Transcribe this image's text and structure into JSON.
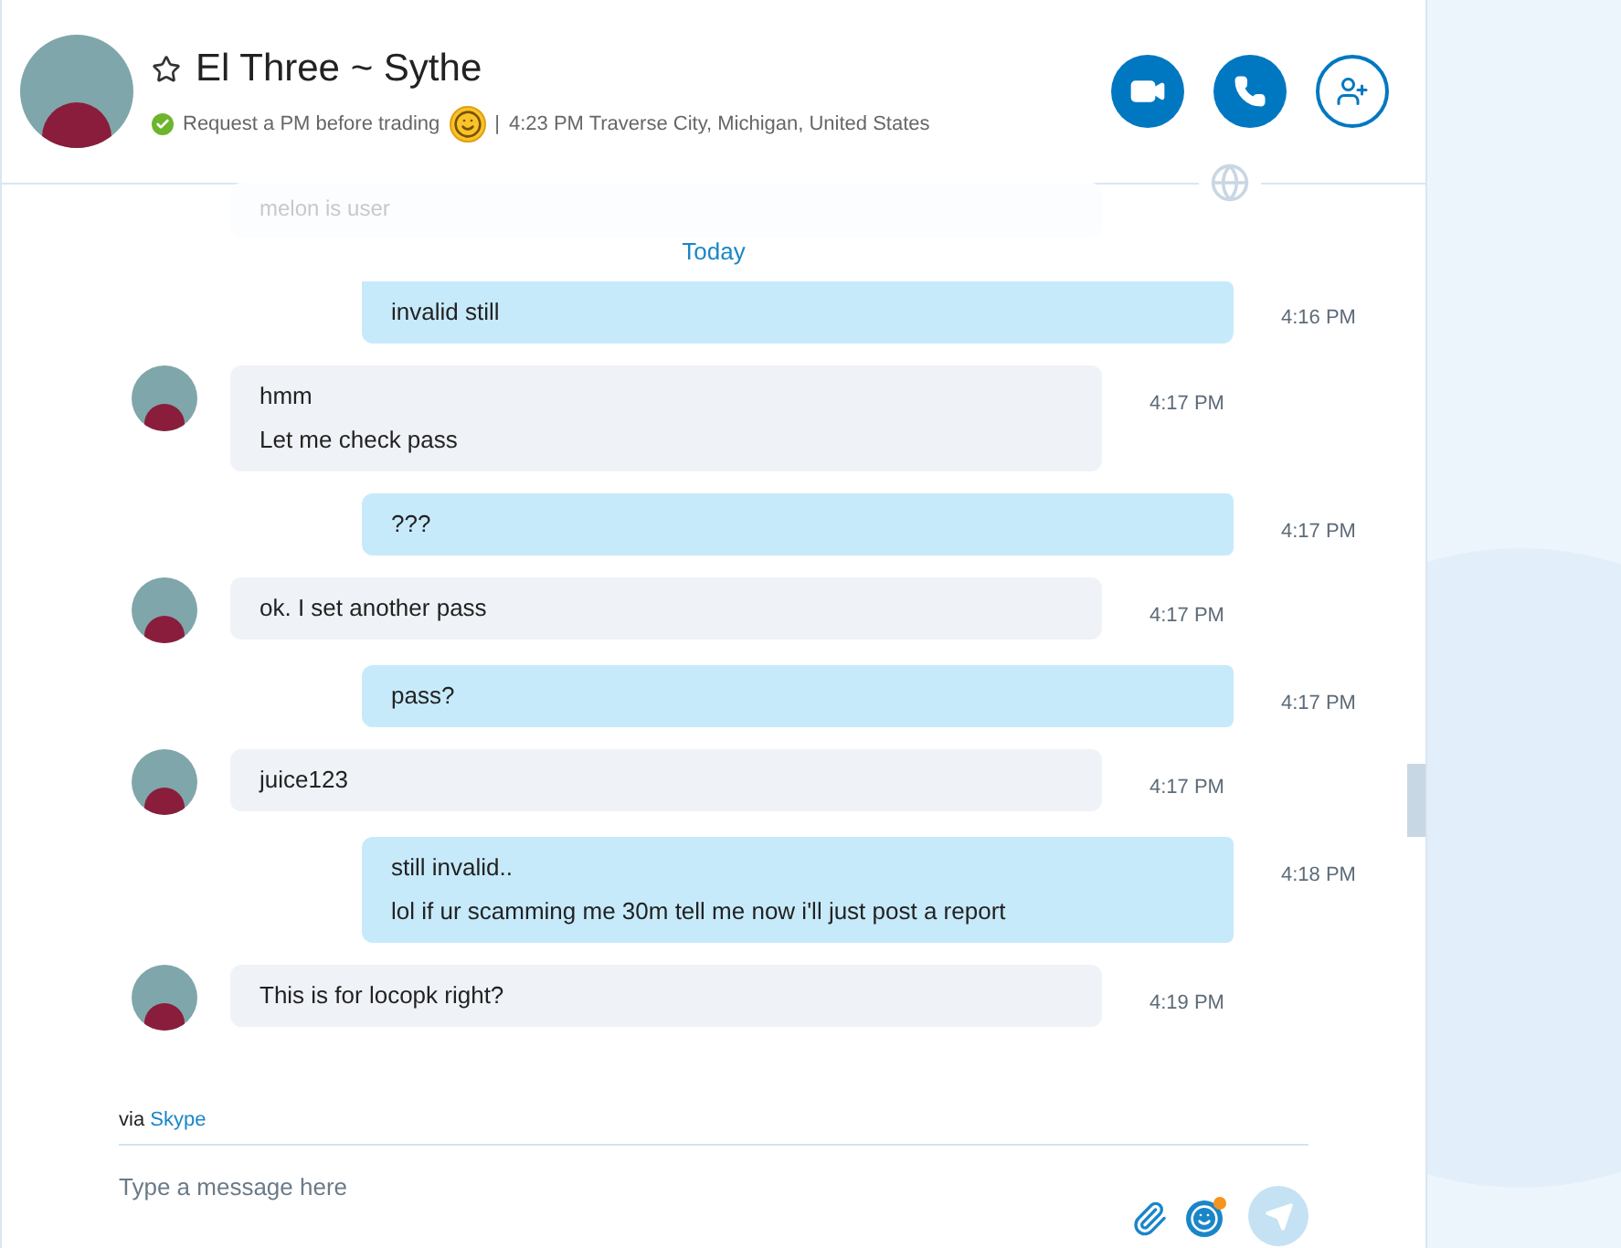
{
  "header": {
    "starred": false,
    "title": "El Three ~ Sythe",
    "mood": "Request a PM before trading",
    "separator": "|",
    "local_info": "4:23 PM Traverse City, Michigan, United States"
  },
  "faded_message": "melon is user",
  "date_divider": "Today",
  "messages": [
    {
      "kind": "sent",
      "lines": [
        "invalid still"
      ],
      "time": "4:16 PM",
      "top_cut": true
    },
    {
      "kind": "received",
      "lines": [
        "hmm",
        "Let me check pass"
      ],
      "time": "4:17 PM"
    },
    {
      "kind": "sent",
      "lines": [
        "???"
      ],
      "time": "4:17 PM"
    },
    {
      "kind": "received",
      "lines": [
        "ok. I set another pass"
      ],
      "time": "4:17 PM"
    },
    {
      "kind": "sent",
      "lines": [
        "pass?"
      ],
      "time": "4:17 PM"
    },
    {
      "kind": "received",
      "lines": [
        "juice123"
      ],
      "time": "4:17 PM"
    },
    {
      "kind": "sent",
      "lines": [
        "still invalid..",
        "lol if ur scamming me 30m tell me now i'll just post a report"
      ],
      "time": "4:18 PM"
    },
    {
      "kind": "received",
      "lines": [
        "This is for locopk right?"
      ],
      "time": "4:19 PM"
    }
  ],
  "via": {
    "prefix": "via",
    "link": "Skype"
  },
  "composer": {
    "placeholder": "Type a message here"
  }
}
